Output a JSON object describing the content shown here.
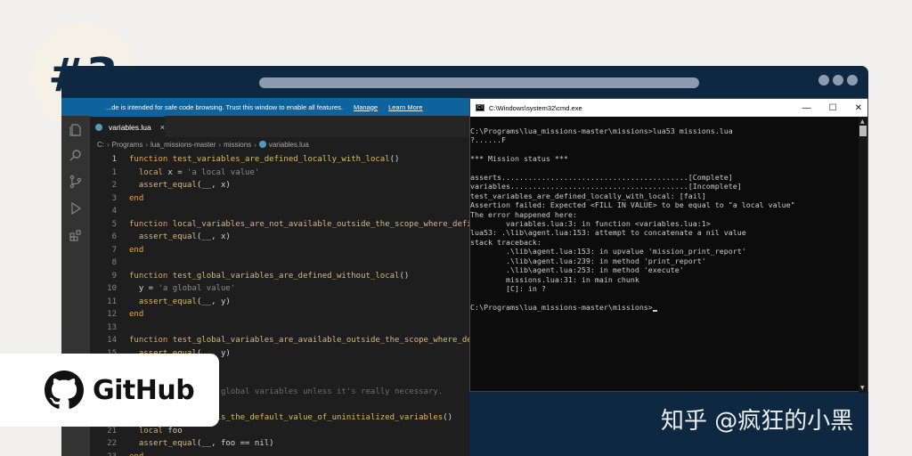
{
  "badge": {
    "text": "#3"
  },
  "window": {
    "banner": {
      "text": "...de is intended for safe code browsing. Trust this window to enable all features.",
      "manage": "Manage",
      "learn_more": "Learn More"
    },
    "tab": {
      "label": "variables.lua",
      "close": "×"
    },
    "breadcrumb": [
      "C:",
      "Programs",
      "lua_missions-master",
      "missions",
      "variables.lua"
    ]
  },
  "editor": {
    "lines": [
      {
        "n": "1",
        "active": true,
        "parts": [
          [
            "kw",
            "function "
          ],
          [
            "fn",
            "test_variables_are_defined_locally_with_local"
          ],
          [
            "code",
            "()"
          ]
        ]
      },
      {
        "n": "1",
        "parts": [
          [
            "code",
            "  "
          ],
          [
            "kw",
            "local"
          ],
          [
            "code",
            " x = "
          ],
          [
            "str",
            "'a local value'"
          ]
        ]
      },
      {
        "n": "2",
        "parts": [
          [
            "code",
            "  "
          ],
          [
            "fn",
            "assert_equal"
          ],
          [
            "code",
            "(__, x)"
          ]
        ]
      },
      {
        "n": "3",
        "parts": [
          [
            "kw",
            "end"
          ]
        ]
      },
      {
        "n": "4",
        "parts": []
      },
      {
        "n": "5",
        "parts": [
          [
            "kw",
            "function "
          ],
          [
            "fn",
            "local_variables_are_not_available_outside_the_scope_where_defined"
          ],
          [
            "code",
            "()"
          ]
        ]
      },
      {
        "n": "6",
        "parts": [
          [
            "code",
            "  "
          ],
          [
            "fn",
            "assert_equal"
          ],
          [
            "code",
            "(__, x)"
          ]
        ]
      },
      {
        "n": "7",
        "parts": [
          [
            "kw",
            "end"
          ]
        ]
      },
      {
        "n": "8",
        "parts": []
      },
      {
        "n": "9",
        "parts": [
          [
            "kw",
            "function "
          ],
          [
            "fn",
            "test_global_variables_are_defined_without_local"
          ],
          [
            "code",
            "()"
          ]
        ]
      },
      {
        "n": "10",
        "parts": [
          [
            "code",
            "  y = "
          ],
          [
            "str",
            "'a global value'"
          ]
        ]
      },
      {
        "n": "11",
        "parts": [
          [
            "code",
            "  "
          ],
          [
            "fn",
            "assert_equal"
          ],
          [
            "code",
            "(__, y)"
          ]
        ]
      },
      {
        "n": "12",
        "parts": [
          [
            "kw",
            "end"
          ]
        ]
      },
      {
        "n": "13",
        "parts": []
      },
      {
        "n": "14",
        "parts": [
          [
            "kw",
            "function "
          ],
          [
            "fn",
            "test_global_variables_are_available_outside_the_scope_where_defined"
          ],
          [
            "code",
            "()"
          ]
        ]
      },
      {
        "n": "15",
        "parts": [
          [
            "code",
            "  "
          ],
          [
            "fn",
            "assert_equal"
          ],
          [
            "code",
            "(__, y)"
          ]
        ]
      },
      {
        "n": "16",
        "parts": [
          [
            "kw",
            "end"
          ]
        ]
      },
      {
        "n": "17",
        "parts": []
      },
      {
        "n": "18",
        "parts": [
          [
            "cmt",
            "-- Avoid using the global variables unless it's really necessary."
          ]
        ]
      },
      {
        "n": "19",
        "parts": []
      },
      {
        "n": "20",
        "parts": [
          [
            "kw",
            "function "
          ],
          [
            "fn",
            "test_nil_is_the_default_value_of_uninitialized_variables"
          ],
          [
            "code",
            "()"
          ]
        ]
      },
      {
        "n": "21",
        "parts": [
          [
            "code",
            "  "
          ],
          [
            "kw",
            "local"
          ],
          [
            "code",
            " foo"
          ]
        ]
      },
      {
        "n": "22",
        "parts": [
          [
            "code",
            "  "
          ],
          [
            "fn",
            "assert_equal"
          ],
          [
            "code",
            "(__, foo == nil)"
          ]
        ]
      },
      {
        "n": "23",
        "parts": [
          [
            "kw",
            "end"
          ]
        ]
      }
    ]
  },
  "cmd": {
    "title": "C:\\Windows\\system32\\cmd.exe",
    "controls": [
      "—",
      "☐",
      "✕"
    ],
    "lines": [
      "C:\\Programs\\lua_missions-master\\missions>lua53 missions.lua",
      "?......F",
      "",
      "*** Mission status ***",
      "",
      "asserts..........................................[Complete]",
      "variables........................................[Incomplete]",
      "test_variables_are_defined_locally_with_local: [fail]",
      "Assertion failed: Expected <FILL IN VALUE> to be equal to \"a local value\"",
      "The error happened here:",
      "        variables.lua:3: in function <variables.lua:1>",
      "lua53: .\\lib\\agent.lua:153: attempt to concatenate a nil value",
      "stack traceback:",
      "        .\\lib\\agent.lua:153: in upvalue 'mission_print_report'",
      "        .\\lib\\agent.lua:239: in method 'print_report'",
      "        .\\lib\\agent.lua:253: in method 'execute'",
      "        missions.lua:31: in main chunk",
      "        [C]: in ?",
      "",
      "C:\\Programs\\lua_missions-master\\missions>"
    ]
  },
  "github": {
    "text": "GitHub"
  },
  "watermark": {
    "text": "知乎 @疯狂的小黑"
  }
}
